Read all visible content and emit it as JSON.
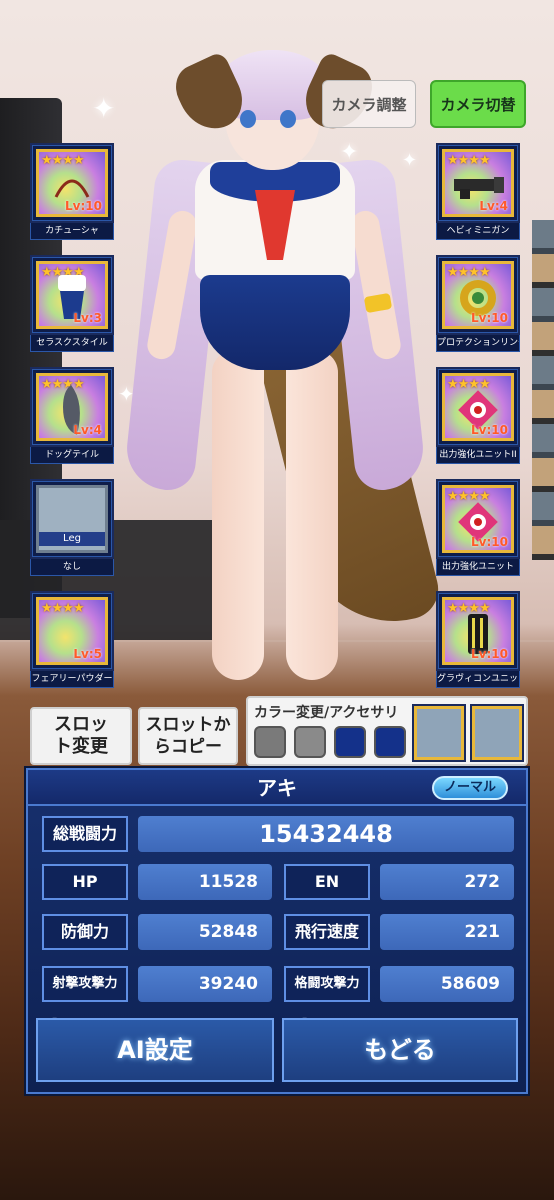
{
  "camera": {
    "adjust_label": "カメラ調整",
    "switch_label": "カメラ切替"
  },
  "slots_left": [
    {
      "name": "カチューシャ",
      "level": "Lv:10",
      "stars": "★★★★"
    },
    {
      "name": "セラスクスタイル",
      "level": "Lv:3",
      "stars": "★★★★"
    },
    {
      "name": "ドッグテイル",
      "level": "Lv:4",
      "stars": "★★★★"
    },
    {
      "name": "なし",
      "tag": "Leg"
    },
    {
      "name": "フェアリーパウダー",
      "level": "Lv:5",
      "stars": "★★★★"
    }
  ],
  "slots_right": [
    {
      "name": "ヘビィミニガン",
      "level": "Lv:4",
      "stars": "★★★★"
    },
    {
      "name": "プロテクションリング",
      "level": "Lv:10",
      "stars": "★★★★"
    },
    {
      "name": "出力強化ユニットII",
      "level": "Lv:10",
      "stars": "★★★★"
    },
    {
      "name": "出力強化ユニット",
      "level": "Lv:10",
      "stars": "★★★★"
    },
    {
      "name": "グラヴィコンユニット",
      "level": "Lv:10",
      "stars": "★★★★"
    }
  ],
  "controls": {
    "slot_change": "スロット変更",
    "slot_copy": "スロットからコピー",
    "color_label": "カラー変更/アクセサリ"
  },
  "swatch_colors": [
    "#7a7a7a",
    "#8a8a8a",
    "#14318a",
    "#14318a"
  ],
  "status": {
    "name": "アキ",
    "rank": "ノーマル",
    "total_label": "総戦闘力",
    "total_value": "15432448",
    "hp_label": "HP",
    "hp_value": "11528",
    "en_label": "EN",
    "en_value": "272",
    "def_label": "防御力",
    "def_value": "52848",
    "speed_label": "飛行速度",
    "speed_value": "221",
    "shoot_label": "射撃攻撃力",
    "shoot_value": "39240",
    "melee_label": "格闘攻撃力",
    "melee_value": "58609"
  },
  "buttons": {
    "ai_label": "AI設定",
    "back_label": "もどる"
  }
}
